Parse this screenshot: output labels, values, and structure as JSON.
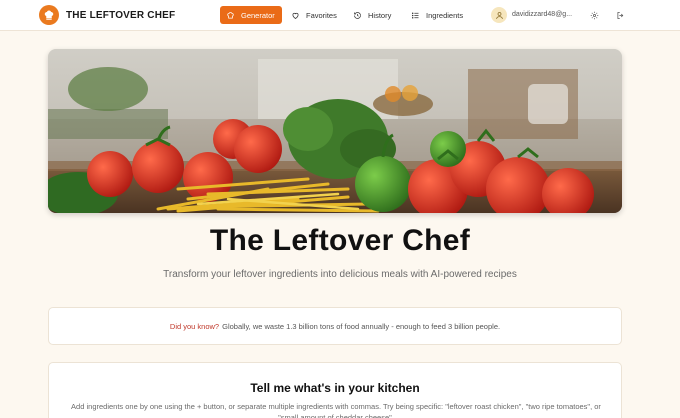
{
  "header": {
    "brand": "THE LEFTOVER CHEF",
    "logo_icon": "chef-hat-icon",
    "nav": [
      {
        "label": "Generator",
        "icon": "chef-hat-icon",
        "active": true
      },
      {
        "label": "Favorites",
        "icon": "heart-icon",
        "active": false
      },
      {
        "label": "History",
        "icon": "history-icon",
        "active": false
      },
      {
        "label": "Ingredients",
        "icon": "list-icon",
        "active": false
      }
    ],
    "user_email": "davidizzard48@g...",
    "settings_icon": "gear-icon",
    "logout_icon": "logout-icon"
  },
  "hero": {
    "image": "fresh vegetables and pasta on a kitchen counter"
  },
  "main": {
    "title": "The Leftover Chef",
    "subtitle": "Transform your leftover ingredients into delicious meals with AI-powered recipes"
  },
  "fact": {
    "lead": "Did you know?",
    "text": "Globally, we waste 1.3 billion tons of food annually - enough to feed 3 billion people."
  },
  "kitchen": {
    "title": "Tell me what's in your kitchen",
    "help": "Add ingredients one by one using the + button, or separate multiple ingredients with commas. Try being specific: \"leftover roast chicken\", \"two ripe tomatoes\", or \"small amount of cheddar cheese\"."
  },
  "colors": {
    "accent": "#ea6b17",
    "page_bg": "#fdf8f0",
    "fact_lead": "#c0392b"
  }
}
